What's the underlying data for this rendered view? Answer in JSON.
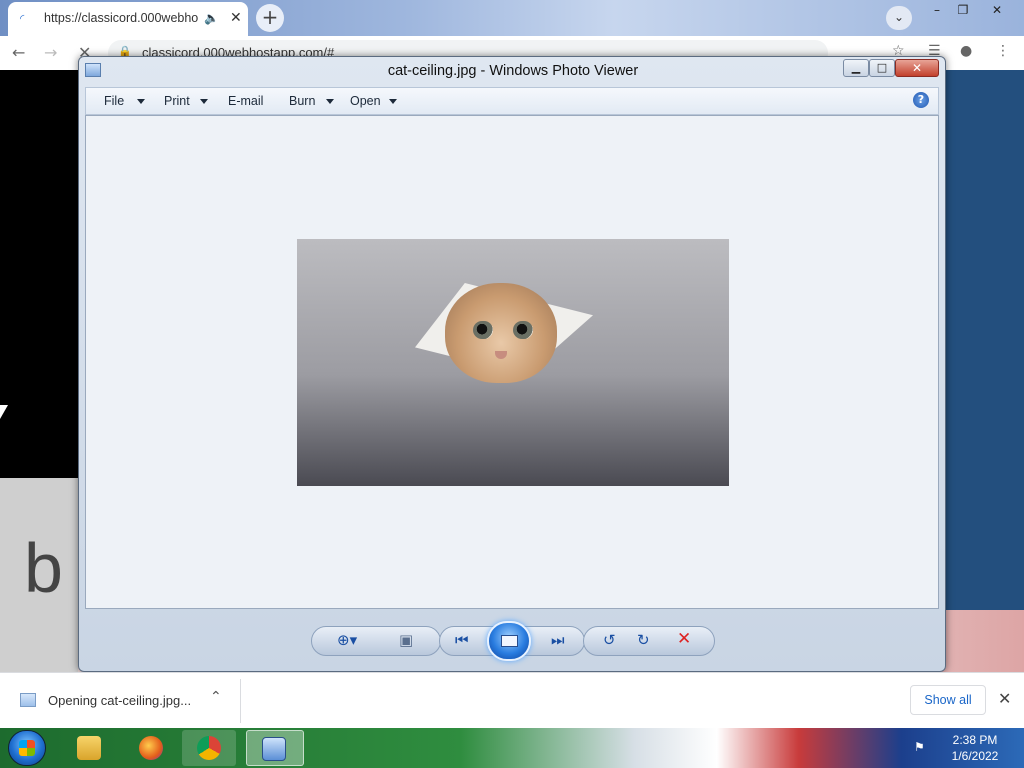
{
  "browser": {
    "tab_title": "https://classicord.000webho",
    "url": "classicord.000webhostapp.com/#",
    "window_controls": {
      "minimize": "–",
      "restore": "❐",
      "close": "✕"
    },
    "new_tab": "+",
    "tab_search": "⌄"
  },
  "viewer": {
    "title": "cat-ceiling.jpg - Windows Photo Viewer",
    "menu": {
      "file": "File",
      "print": "Print",
      "email": "E-mail",
      "burn": "Burn",
      "open": "Open"
    },
    "help": "?",
    "controls": {
      "zoom": "zoom-icon",
      "fit": "fit-window-icon",
      "previous": "previous-icon",
      "slideshow": "slideshow-icon",
      "next": "next-icon",
      "rotate_ccw": "rotate-left-icon",
      "rotate_cw": "rotate-right-icon",
      "delete": "delete-icon"
    }
  },
  "downloads": {
    "item_text": "Opening cat-ceiling.jpg...",
    "show_all": "Show all"
  },
  "taskbar": {
    "time": "2:38 PM",
    "date": "1/6/2022"
  },
  "colors": {
    "taskbar_green": "#2f8d3f",
    "close_red": "#c2402c",
    "link_blue": "#1a66c8"
  }
}
